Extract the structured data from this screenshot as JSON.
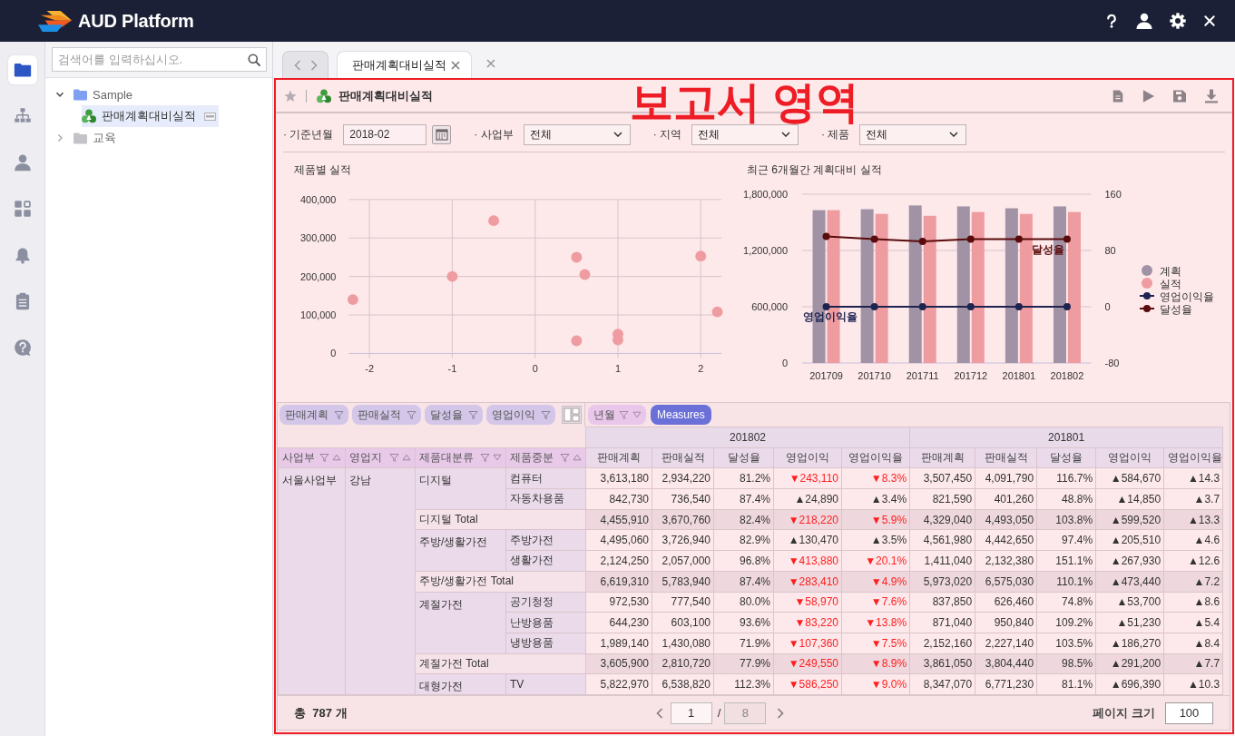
{
  "header": {
    "brand": "AUD Platform"
  },
  "rail": [
    {
      "selected": true
    },
    {
      "selected": false
    },
    {
      "selected": false
    },
    {
      "selected": false
    },
    {
      "selected": false
    },
    {
      "selected": false
    },
    {
      "selected": false
    }
  ],
  "search": {
    "placeholder": "검색어를 입력하십시오."
  },
  "tree": [
    {
      "label": "Sample",
      "kind": "folder",
      "expanded": true,
      "selected": false,
      "children": [
        {
          "label": "판매계획대비실적",
          "kind": "report",
          "selected": true
        }
      ]
    },
    {
      "label": "교육",
      "kind": "folder",
      "expanded": false,
      "selected": false
    }
  ],
  "tabs": [
    {
      "label": "판매계획대비실적",
      "selected": true
    }
  ],
  "report": {
    "title": "판매계획대비실적",
    "favorite": false,
    "overlay_label": "보고서 영역"
  },
  "filters": [
    {
      "label": "· 기준년월",
      "kind": "date",
      "value": "2018-02"
    },
    {
      "label": "· 사업부",
      "kind": "select",
      "value": "전체"
    },
    {
      "label": "· 지역",
      "kind": "select",
      "value": "전체"
    },
    {
      "label": "· 제품",
      "kind": "select",
      "value": "전체"
    }
  ],
  "charts": [
    {
      "chart_data": {
        "type": "scatter",
        "title": "제품별 실적",
        "x": [
          -2.2,
          -1,
          -0.5,
          0.5,
          0.6,
          0.5,
          1,
          1,
          2,
          2.2
        ],
        "series": [
          {
            "color": "#ef9ca0",
            "values": [
              140000,
              200000,
              345000,
              250000,
              205000,
              33000,
              50000,
              35000,
              253000,
              108000
            ]
          }
        ],
        "xlim": [
          -2.25,
          2.25
        ],
        "ylim": [
          0,
          400000
        ],
        "xticks": [
          -2,
          -1,
          0,
          1,
          2
        ],
        "yticks": [
          0,
          {
            "value": 100000,
            "label": "100,000"
          },
          {
            "value": 200000,
            "label": "200,000"
          },
          {
            "value": 300000,
            "label": "300,000"
          },
          {
            "value": 400000,
            "label": "400,000"
          }
        ],
        "grid": true
      }
    },
    {
      "chart_data": {
        "type": "bar",
        "title": "최근 6개월간 계획대비 실적",
        "categories": [
          "201709",
          "201710",
          "201711",
          "201712",
          "201801",
          "201802"
        ],
        "series": [
          {
            "name": "계획",
            "type": "bar",
            "color": "#a193a5",
            "values": [
              1630000,
              1640000,
              1680000,
              1670000,
              1650000,
              1670000
            ]
          },
          {
            "name": "실적",
            "type": "bar",
            "color": "#ef9ca0",
            "values": [
              1630000,
              1590000,
              1570000,
              1610000,
              1590000,
              1610000
            ]
          },
          {
            "name": "영업이익율",
            "type": "line",
            "axis": "y2",
            "marker": "circle",
            "color": "#1e2350",
            "values": [
              0,
              0,
              0,
              0,
              0,
              0
            ]
          },
          {
            "name": "달성율",
            "type": "line",
            "axis": "y2",
            "marker": "circle",
            "color": "#5a0b0b",
            "values": [
              100,
              96,
              93,
              96,
              96,
              96
            ]
          }
        ],
        "ylim": [
          0,
          1800000
        ],
        "yticks": [
          0,
          {
            "value": 600000,
            "label": "600,000"
          },
          {
            "value": 1200000,
            "label": "1,200,000"
          },
          {
            "value": 1800000,
            "label": "1,800,000"
          }
        ],
        "y2lim": [
          -80,
          160
        ],
        "y2ticks": [
          -80,
          0,
          80,
          160
        ],
        "grid": true,
        "legend": "right",
        "annotations": [
          "영업이익율",
          "달성율"
        ]
      }
    }
  ],
  "pivot": {
    "measure_chips": [
      {
        "label": "판매계획"
      },
      {
        "label": "판매실적"
      },
      {
        "label": "달성율"
      },
      {
        "label": "영업이익"
      }
    ],
    "column_chips": [
      {
        "label": "년월",
        "kind": "dimension"
      },
      {
        "label": "Measures",
        "kind": "measures"
      }
    ],
    "row_headers": [
      {
        "label": "사업부",
        "descending": false
      },
      {
        "label": "영업지",
        "descending": false
      },
      {
        "label": "제품대분류",
        "descending": true
      },
      {
        "label": "제품중분",
        "descending": false
      }
    ],
    "column_groups": [
      {
        "label": "201802",
        "measures": [
          "판매계획",
          "판매실적",
          "달성율",
          "영업이익",
          "영업이익율"
        ]
      },
      {
        "label": "201801",
        "measures": [
          "판매계획",
          "판매실적",
          "달성율",
          "영업이익",
          "영업이익율"
        ]
      }
    ],
    "rows": [
      {
        "label": "서울사업부",
        "children": [
          {
            "label": "강남",
            "children": [
              {
                "label": "디지털",
                "children": [
                  {
                    "label": "컴퓨터",
                    "cells": [
                      "3,613,180",
                      "2,934,220",
                      "81.2%",
                      {
                        "text": "▼243,110",
                        "down": true
                      },
                      {
                        "text": "▼8.3%",
                        "down": true
                      },
                      "3,507,450",
                      "4,091,790",
                      "116.7%",
                      {
                        "text": "▲584,670",
                        "down": false
                      },
                      {
                        "text": "▲14.3",
                        "down": false
                      }
                    ]
                  },
                  {
                    "label": "자동차용품",
                    "cells": [
                      "842,730",
                      "736,540",
                      "87.4%",
                      {
                        "text": "▲24,890",
                        "down": false
                      },
                      {
                        "text": "▲3.4%",
                        "down": false
                      },
                      "821,590",
                      "401,260",
                      "48.8%",
                      {
                        "text": "▲14,850",
                        "down": false
                      },
                      {
                        "text": "▲3.7",
                        "down": false
                      }
                    ]
                  }
                ],
                "total": {
                  "label": "디지털 Total",
                  "cells": [
                    "4,455,910",
                    "3,670,760",
                    "82.4%",
                    {
                      "text": "▼218,220",
                      "down": true
                    },
                    {
                      "text": "▼5.9%",
                      "down": true
                    },
                    "4,329,040",
                    "4,493,050",
                    "103.8%",
                    {
                      "text": "▲599,520",
                      "down": false
                    },
                    {
                      "text": "▲13.3",
                      "down": false
                    }
                  ]
                }
              },
              {
                "label": "주방/생활가전",
                "children": [
                  {
                    "label": "주방가전",
                    "cells": [
                      "4,495,060",
                      "3,726,940",
                      "82.9%",
                      {
                        "text": "▲130,470",
                        "down": false
                      },
                      {
                        "text": "▲3.5%",
                        "down": false
                      },
                      "4,561,980",
                      "4,442,650",
                      "97.4%",
                      {
                        "text": "▲205,510",
                        "down": false
                      },
                      {
                        "text": "▲4.6",
                        "down": false
                      }
                    ]
                  },
                  {
                    "label": "생활가전",
                    "cells": [
                      "2,124,250",
                      "2,057,000",
                      "96.8%",
                      {
                        "text": "▼413,880",
                        "down": true
                      },
                      {
                        "text": "▼20.1%",
                        "down": true
                      },
                      "1,411,040",
                      "2,132,380",
                      "151.1%",
                      {
                        "text": "▲267,930",
                        "down": false
                      },
                      {
                        "text": "▲12.6",
                        "down": false
                      }
                    ]
                  }
                ],
                "total": {
                  "label": "주방/생활가전 Total",
                  "cells": [
                    "6,619,310",
                    "5,783,940",
                    "87.4%",
                    {
                      "text": "▼283,410",
                      "down": true
                    },
                    {
                      "text": "▼4.9%",
                      "down": true
                    },
                    "5,973,020",
                    "6,575,030",
                    "110.1%",
                    {
                      "text": "▲473,440",
                      "down": false
                    },
                    {
                      "text": "▲7.2",
                      "down": false
                    }
                  ]
                }
              },
              {
                "label": "계절가전",
                "children": [
                  {
                    "label": "공기청정",
                    "cells": [
                      "972,530",
                      "777,540",
                      "80.0%",
                      {
                        "text": "▼58,970",
                        "down": true
                      },
                      {
                        "text": "▼7.6%",
                        "down": true
                      },
                      "837,850",
                      "626,460",
                      "74.8%",
                      {
                        "text": "▲53,700",
                        "down": false
                      },
                      {
                        "text": "▲8.6",
                        "down": false
                      }
                    ]
                  },
                  {
                    "label": "난방용품",
                    "cells": [
                      "644,230",
                      "603,100",
                      "93.6%",
                      {
                        "text": "▼83,220",
                        "down": true
                      },
                      {
                        "text": "▼13.8%",
                        "down": true
                      },
                      "871,040",
                      "950,840",
                      "109.2%",
                      {
                        "text": "▲51,230",
                        "down": false
                      },
                      {
                        "text": "▲5.4",
                        "down": false
                      }
                    ]
                  },
                  {
                    "label": "냉방용품",
                    "cells": [
                      "1,989,140",
                      "1,430,080",
                      "71.9%",
                      {
                        "text": "▼107,360",
                        "down": true
                      },
                      {
                        "text": "▼7.5%",
                        "down": true
                      },
                      "2,152,160",
                      "2,227,140",
                      "103.5%",
                      {
                        "text": "▲186,270",
                        "down": false
                      },
                      {
                        "text": "▲8.4",
                        "down": false
                      }
                    ]
                  }
                ],
                "total": {
                  "label": "계절가전 Total",
                  "cells": [
                    "3,605,900",
                    "2,810,720",
                    "77.9%",
                    {
                      "text": "▼249,550",
                      "down": true
                    },
                    {
                      "text": "▼8.9%",
                      "down": true
                    },
                    "3,861,050",
                    "3,804,440",
                    "98.5%",
                    {
                      "text": "▲291,200",
                      "down": false
                    },
                    {
                      "text": "▲7.7",
                      "down": false
                    }
                  ]
                }
              },
              {
                "label": "대형가전",
                "children": [
                  {
                    "label": "TV",
                    "cells": [
                      "5,822,970",
                      "6,538,820",
                      "112.3%",
                      {
                        "text": "▼586,250",
                        "down": true
                      },
                      {
                        "text": "▼9.0%",
                        "down": true
                      },
                      "8,347,070",
                      "6,771,230",
                      "81.1%",
                      {
                        "text": "▲696,390",
                        "down": false
                      },
                      {
                        "text": "▲10.3",
                        "down": false
                      }
                    ]
                  }
                ]
              }
            ]
          }
        ]
      }
    ],
    "footer": {
      "total": "총  787 개",
      "page": "1",
      "separator": "/",
      "pages": {
        "text": "8",
        "disabled": true
      },
      "page_size_label": "페이지 크기",
      "page_size": "100"
    }
  }
}
